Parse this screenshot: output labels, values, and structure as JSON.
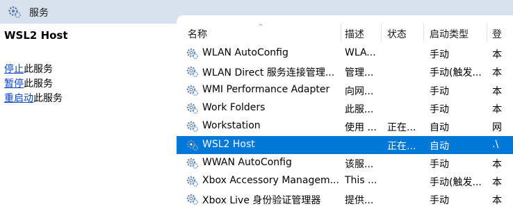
{
  "window": {
    "title": "服务"
  },
  "left_pane": {
    "service_name": "WSL2 Host",
    "actions": [
      {
        "link": "停止",
        "rest": "此服务"
      },
      {
        "link": "暂停",
        "rest": "此服务"
      },
      {
        "link": "重启动",
        "rest": "此服务"
      }
    ]
  },
  "columns": {
    "name": "名称",
    "description": "描述",
    "status": "状态",
    "startup_type": "启动类型",
    "logon_as": "登"
  },
  "rows": [
    {
      "name": "WLAN AutoConfig",
      "description": "WLA...",
      "status": "",
      "startup_type": "手动",
      "logon_as": "本"
    },
    {
      "name": "WLAN Direct 服务连接管理...",
      "description": "管理...",
      "status": "",
      "startup_type": "手动(触发...",
      "logon_as": "本"
    },
    {
      "name": "WMI Performance Adapter",
      "description": "向网...",
      "status": "",
      "startup_type": "手动",
      "logon_as": "本"
    },
    {
      "name": "Work Folders",
      "description": "此服...",
      "status": "",
      "startup_type": "手动",
      "logon_as": "本"
    },
    {
      "name": "Workstation",
      "description": "使用 ...",
      "status": "正在...",
      "startup_type": "自动",
      "logon_as": "网"
    },
    {
      "name": "WSL2 Host",
      "description": "",
      "status": "正在...",
      "startup_type": "自动",
      "logon_as": ".\\"
    },
    {
      "name": "WWAN AutoConfig",
      "description": "该服...",
      "status": "",
      "startup_type": "手动",
      "logon_as": "本"
    },
    {
      "name": "Xbox Accessory Managem...",
      "description": "This ...",
      "status": "",
      "startup_type": "手动(触发...",
      "logon_as": "本"
    },
    {
      "name": "Xbox Live 身份验证管理器",
      "description": "提供...",
      "status": "",
      "startup_type": "手动",
      "logon_as": "本"
    }
  ],
  "selected_row": 5,
  "colors": {
    "selection": "#0078d7",
    "titlebar": "#d8e2ee",
    "link": "#0645c2"
  }
}
